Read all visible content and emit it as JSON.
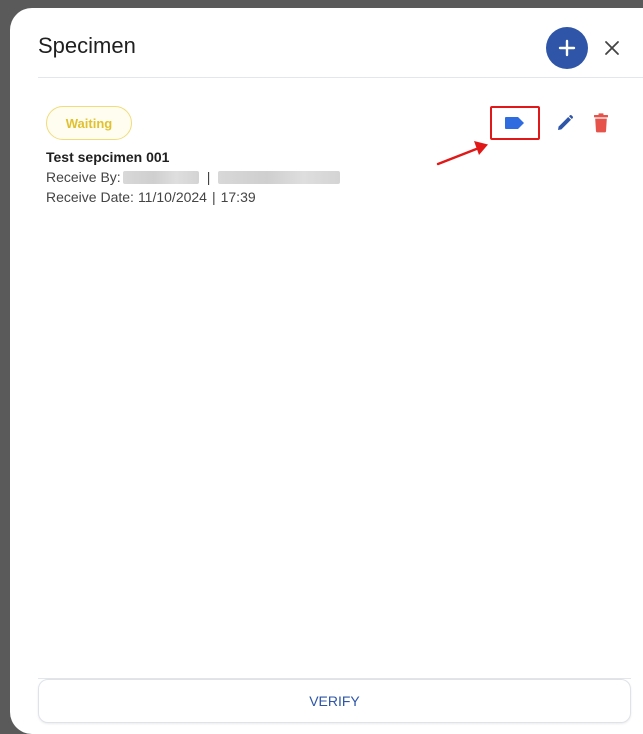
{
  "dialog": {
    "title": "Specimen",
    "add_icon": "plus-icon",
    "close_icon": "close-icon"
  },
  "specimen": {
    "status": "Waiting",
    "name": "Test sepcimen 001",
    "receive_by_label": "Receive By:",
    "separator": "|",
    "receive_date_label": "Receive Date:",
    "receive_date": "11/10/2024",
    "receive_time": "17:39"
  },
  "actions": {
    "tag_icon": "label-tag-icon",
    "edit_icon": "pencil-icon",
    "delete_icon": "trash-icon"
  },
  "footer": {
    "verify_label": "VERIFY"
  },
  "colors": {
    "primary": "#2e55a8",
    "tag_blue": "#2f6ce0",
    "delete_red": "#e5534b",
    "status_yellow": "#e0c12f",
    "highlight_red": "#e01818"
  }
}
